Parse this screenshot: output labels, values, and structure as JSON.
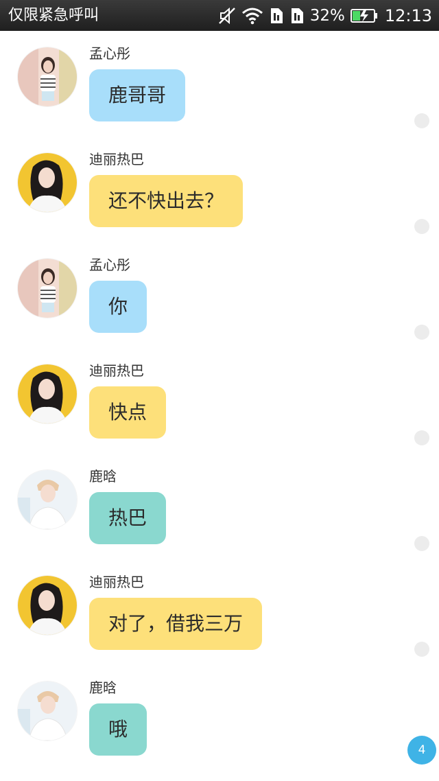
{
  "status_bar": {
    "carrier_text": "仅限紧急呼叫",
    "battery_percent": "32%",
    "time": "12:13",
    "icons": [
      "mute-icon",
      "wifi-icon",
      "sim-icon",
      "sim-icon",
      "battery-charging-icon"
    ]
  },
  "messages": [
    {
      "sender": "孟心彤",
      "text": "鹿哥哥",
      "color": "#a8defa",
      "avatar": "avatar-mengxintong"
    },
    {
      "sender": "迪丽热巴",
      "text": "还不快出去？",
      "color": "#fde07a",
      "avatar": "avatar-dilireba"
    },
    {
      "sender": "孟心彤",
      "text": "你",
      "color": "#a8defa",
      "avatar": "avatar-mengxintong"
    },
    {
      "sender": "迪丽热巴",
      "text": "快点",
      "color": "#fde07a",
      "avatar": "avatar-dilireba"
    },
    {
      "sender": "鹿晗",
      "text": "热巴",
      "color": "#8ad8cf",
      "avatar": "avatar-luhan"
    },
    {
      "sender": "迪丽热巴",
      "text": "对了，借我三万",
      "color": "#fde07a",
      "avatar": "avatar-dilireba"
    },
    {
      "sender": "鹿晗",
      "text": "哦",
      "color": "#8ad8cf",
      "avatar": "avatar-luhan"
    }
  ],
  "unread_count": "4"
}
